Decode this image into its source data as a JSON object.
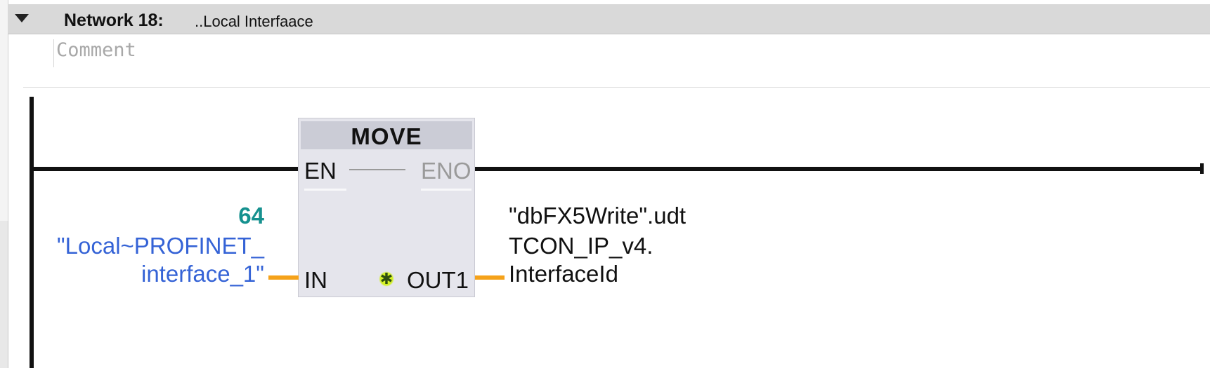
{
  "network": {
    "title": "Network 18:",
    "description": "..Local Interfaace",
    "comment_placeholder": "Comment"
  },
  "block": {
    "name": "MOVE",
    "pins": {
      "en": "EN",
      "eno": "ENO",
      "in": "IN",
      "out1": "OUT1"
    },
    "star_glyph": "✱"
  },
  "input": {
    "constant": "64",
    "tag_line1": "\"Local~PROFINET_",
    "tag_line2": "interface_1\""
  },
  "output": {
    "tag_line1": "\"dbFX5Write\".udt",
    "tag_line2": "TCON_IP_v4.",
    "tag_line3": "InterfaceId"
  },
  "colors": {
    "header_bg": "#d9d9d9",
    "wire_orange": "#f5a21a",
    "constant_teal": "#16918f",
    "tag_blue": "#3563d6",
    "box_bg": "#e5e5ec",
    "box_title_bg": "#cbccd6",
    "disabled_gray": "#9a9a9a"
  },
  "icons": {
    "collapse": "triangle-down-icon",
    "add_input": "star-icon"
  }
}
